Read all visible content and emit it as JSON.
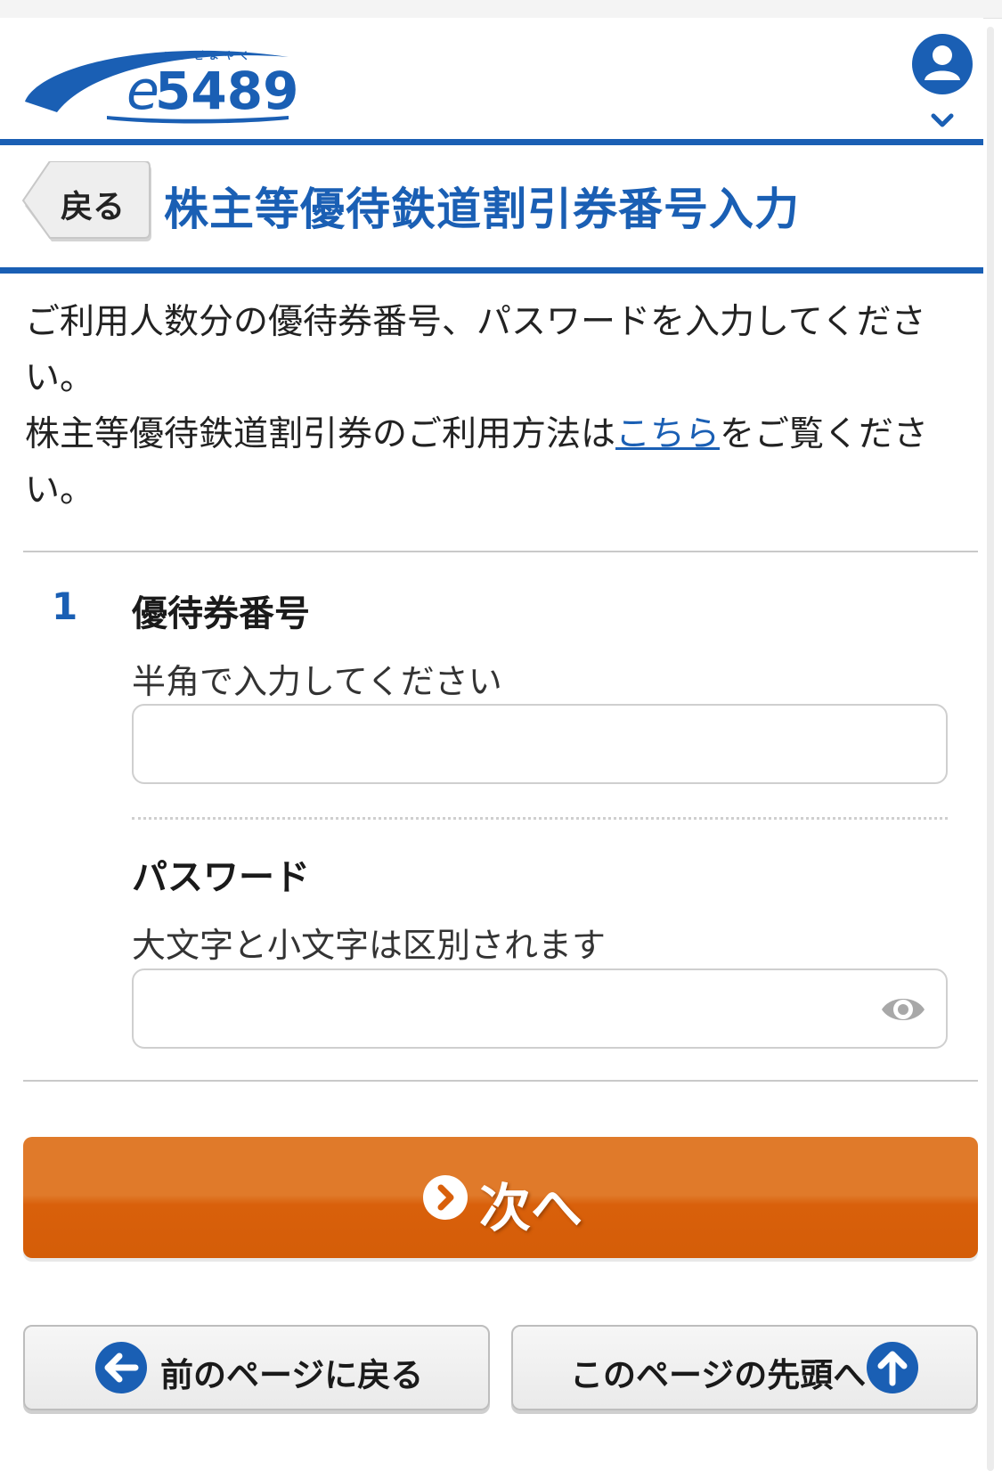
{
  "header": {
    "logo_text": "e5489",
    "logo_ruby": "いいごよやく",
    "account_icon": "person-icon"
  },
  "title": {
    "back_label": "戻る",
    "page_title": "株主等優待鉄道割引券番号入力"
  },
  "intro": {
    "line1": "ご利用人数分の優待券番号、パスワードを入力してください。",
    "line2_before": "株主等優待鉄道割引券のご利用方法は",
    "line2_link": "こちら",
    "line2_after": "をご覧ください。"
  },
  "form": {
    "number": "1",
    "ticket_number": {
      "label": "優待券番号",
      "hint": "半角で入力してください",
      "value": ""
    },
    "password": {
      "label": "パスワード",
      "hint": "大文字と小文字は区別されます",
      "value": "",
      "toggle_icon": "eye-icon"
    }
  },
  "actions": {
    "next_label": "次へ",
    "back_page_label": "前のページに戻る",
    "top_label": "このページの先頭へ"
  },
  "colors": {
    "brand_blue": "#1a5fb4",
    "next_orange": "#d9600b"
  }
}
